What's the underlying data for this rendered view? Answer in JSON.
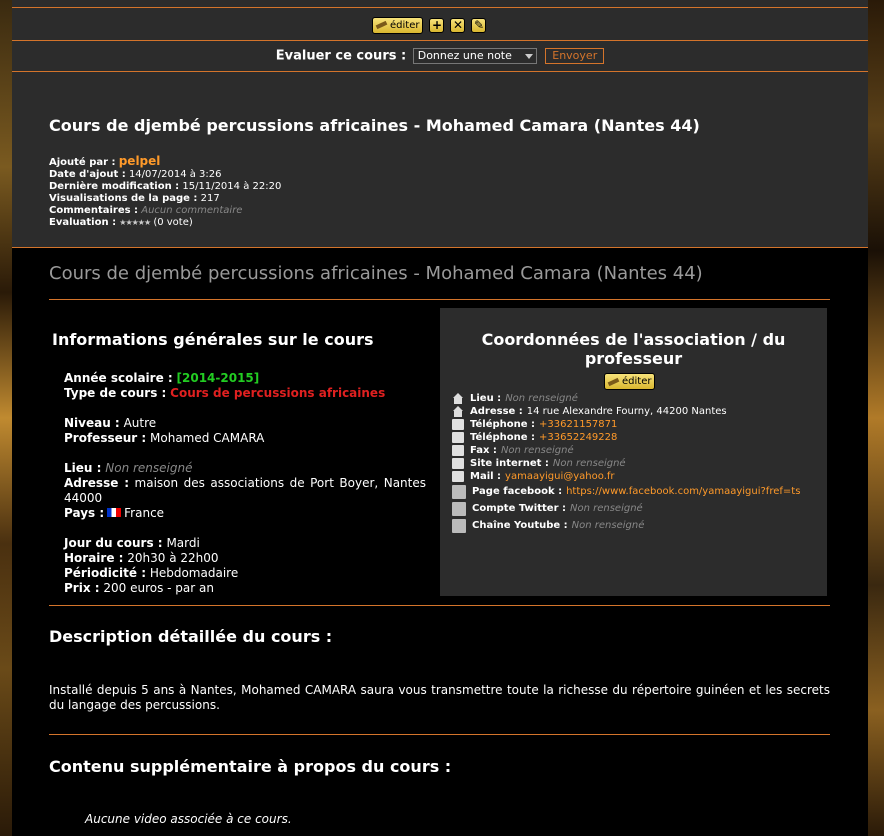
{
  "toolbar": {
    "edit_label": "éditer",
    "add_icon": "plus-icon",
    "delete_icon": "close-icon",
    "extra_icon": "edit-note-icon"
  },
  "rating": {
    "label": "Evaluer ce cours :",
    "select_value": "Donnez une note",
    "send_label": "Envoyer"
  },
  "header": {
    "title": "Cours de djembé percussions africaines - Mohamed Camara (Nantes 44)",
    "added_by_label": "Ajouté par :",
    "added_by": "pelpel",
    "date_added_label": "Date d'ajout :",
    "date_added": "14/07/2014 à 3:26",
    "last_modified_label": "Dernière modification :",
    "last_modified": "15/11/2014 à 22:20",
    "views_label": "Visualisations de la page :",
    "views": "217",
    "comments_label": "Commentaires :",
    "comments": "Aucun commentaire",
    "evaluation_label": "Evaluation :",
    "evaluation_stars": "★★★★★",
    "evaluation_votes": "(0 vote)"
  },
  "main_title": "Cours de djembé percussions africaines - Mohamed Camara (Nantes 44)",
  "general": {
    "heading": "Informations générales sur le cours",
    "year_label": "Année scolaire :",
    "year": "[2014-2015]",
    "type_label": "Type de cours :",
    "type": "Cours de percussions africaines",
    "level_label": "Niveau :",
    "level": "Autre",
    "teacher_label": "Professeur :",
    "teacher": "Mohamed CAMARA",
    "place_label": "Lieu :",
    "place": "Non renseigné",
    "address_label": "Adresse :",
    "address": "maison des associations de Port Boyer, Nantes 44000",
    "country_label": "Pays :",
    "country": "France",
    "day_label": "Jour du cours :",
    "day": "Mardi",
    "hours_label": "Horaire :",
    "hours": "20h30 à 22h00",
    "periodicity_label": "Périodicité :",
    "periodicity": "Hebdomadaire",
    "price_label": "Prix :",
    "price": "200 euros - par an"
  },
  "contact": {
    "heading": "Coordonnées de l'association / du professeur",
    "edit_label": "éditer",
    "place_label": "Lieu :",
    "place": "Non renseigné",
    "address_label": "Adresse :",
    "address": "14 rue Alexandre Fourny, 44200 Nantes",
    "phone1_label": "Téléphone :",
    "phone1": "+33621157871",
    "phone2_label": "Téléphone :",
    "phone2": "+33652249228",
    "fax_label": "Fax :",
    "fax": "Non renseigné",
    "website_label": "Site internet :",
    "website": "Non renseigné",
    "mail_label": "Mail :",
    "mail": "yamaayigui@yahoo.fr",
    "facebook_label": "Page facebook :",
    "facebook": "https://www.facebook.com/yamaayigui?fref=ts",
    "twitter_label": "Compte Twitter :",
    "twitter": "Non renseigné",
    "youtube_label": "Chaîne Youtube :",
    "youtube": "Non renseigné"
  },
  "description": {
    "heading": "Description détaillée du cours :",
    "text": "Installé depuis 5 ans à Nantes, Mohamed CAMARA saura vous transmettre toute la richesse du répertoire guinéen et les secrets du langage des percussions."
  },
  "extra": {
    "heading": "Contenu supplémentaire à propos du cours :",
    "no_video": "Aucune video associée à ce cours."
  }
}
